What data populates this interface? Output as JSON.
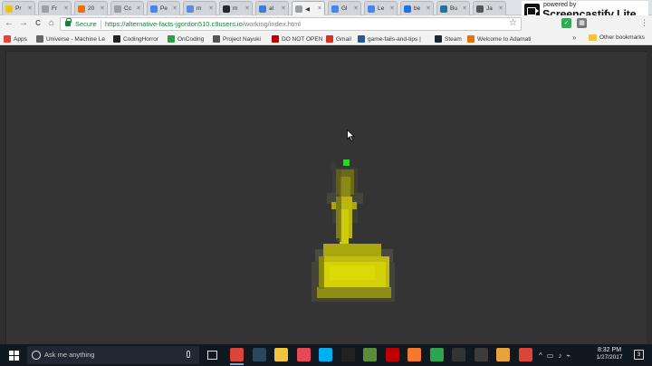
{
  "browser": {
    "tabs": [
      {
        "label": "Pr",
        "color": "#f4c20d",
        "active": false
      },
      {
        "label": "Fr",
        "color": "#9aa0a6",
        "active": false
      },
      {
        "label": "20",
        "color": "#e8710a",
        "active": false
      },
      {
        "label": "Cc",
        "color": "#9aa0a6",
        "active": false
      },
      {
        "label": "Pe",
        "color": "#4285f4",
        "active": false
      },
      {
        "label": "m",
        "color": "#5c8ae6",
        "active": false
      },
      {
        "label": "m",
        "color": "#24292e",
        "active": false
      },
      {
        "label": "al",
        "color": "#3b7dd8",
        "active": false
      },
      {
        "label": "◀",
        "color": "#9aa0a6",
        "active": true
      },
      {
        "label": "Gl",
        "color": "#4285f4",
        "active": false
      },
      {
        "label": "Le",
        "color": "#4285f4",
        "active": false
      },
      {
        "label": "be",
        "color": "#1a73e8",
        "active": false
      },
      {
        "label": "Bu",
        "color": "#21759b",
        "active": false
      },
      {
        "label": "Ja",
        "color": "#555555",
        "active": false
      }
    ],
    "tab_close_glyph": "×",
    "nav": {
      "back": "←",
      "forward": "→",
      "reload": "C",
      "home": "⌂"
    },
    "address": {
      "secure_label": "Secure",
      "url_host": "https://alternative-facts-jgordon510.c9users.io",
      "url_path": "/working/index.html"
    },
    "star_glyph": "☆",
    "extensions": [
      {
        "glyph": "✓",
        "color": "#34a853"
      },
      {
        "glyph": "▦",
        "color": "#777777"
      },
      {
        "glyph": "⋮",
        "color": "#777777"
      }
    ],
    "bookmarks": [
      {
        "label": "Apps",
        "color": "#ea4335"
      },
      {
        "label": "Universe - Machine Le",
        "color": "#666666"
      },
      {
        "label": "CodingHorror",
        "color": "#222222"
      },
      {
        "label": "OnCoding",
        "color": "#2f9e44"
      },
      {
        "label": "Project Nayuki",
        "color": "#555555"
      },
      {
        "label": "DO NOT OPEN",
        "color": "#c00000"
      },
      {
        "label": "Gmail",
        "color": "#d93025"
      },
      {
        "label": "game-fails-and-tips |",
        "color": "#2b5797"
      },
      {
        "label": "Steam",
        "color": "#1b2838"
      },
      {
        "label": "Welcome to Adamati",
        "color": "#e8710a"
      }
    ],
    "bookmarks_overflow": "»",
    "other_bookmarks": "Other bookmarks"
  },
  "watermark": {
    "small": "powered by",
    "big": "Screencastify Lite"
  },
  "taskbar": {
    "search_placeholder": "Ask me anything",
    "apps": [
      {
        "name": "chrome",
        "color": "#db4437",
        "running": true
      },
      {
        "name": "steam",
        "color": "#2a475e",
        "running": false
      },
      {
        "name": "explorer",
        "color": "#f0c43f",
        "running": false
      },
      {
        "name": "photos",
        "color": "#e74856",
        "running": false
      },
      {
        "name": "skype",
        "color": "#00aff0",
        "running": false
      },
      {
        "name": "unity",
        "color": "#222222",
        "running": false
      },
      {
        "name": "minecraft",
        "color": "#5b8c3a",
        "running": false
      },
      {
        "name": "filezilla",
        "color": "#bf0000",
        "running": false
      },
      {
        "name": "blender",
        "color": "#f5792a",
        "running": false
      },
      {
        "name": "app-green",
        "color": "#2ea44f",
        "running": false
      },
      {
        "name": "unity-2",
        "color": "#333333",
        "running": false
      },
      {
        "name": "terminal",
        "color": "#3c3c3c",
        "running": false
      },
      {
        "name": "paint",
        "color": "#e8a33d",
        "running": false
      },
      {
        "name": "chrome-2",
        "color": "#db4437",
        "running": false
      }
    ],
    "tray": [
      "^",
      "▭",
      "♪",
      "⌁"
    ],
    "time": "8:32 PM",
    "date": "1/27/2017",
    "notifications": "3"
  }
}
